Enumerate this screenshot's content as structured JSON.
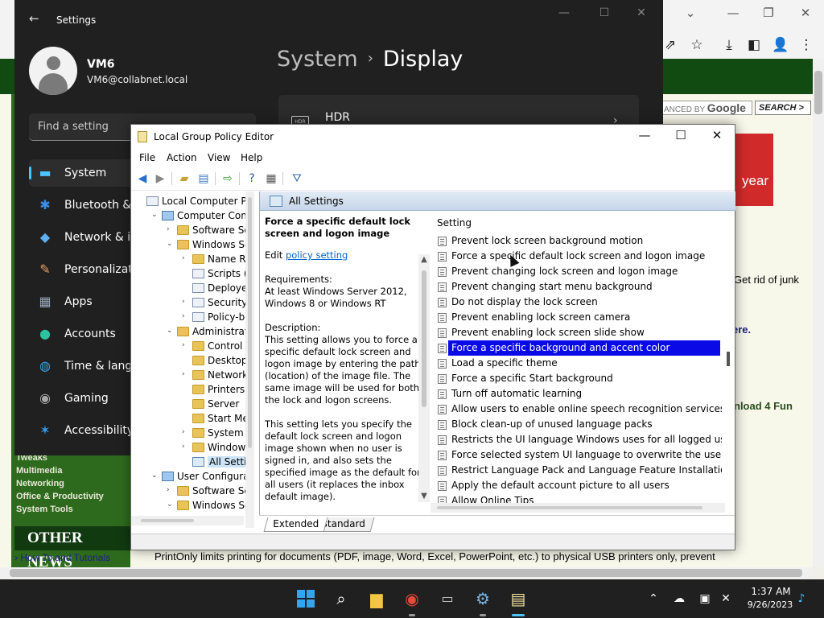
{
  "browser": {
    "google_search_placeholder": "ANCED BY",
    "google_word": "Google",
    "search_button": "SEARCH >",
    "ad_text": "year",
    "get_rid": "Get rid of junk",
    "here": "ere.",
    "download": "nload 4 Fun",
    "categories": [
      "Tweaks",
      "Multimedia",
      "Networking",
      "Office & Productivity",
      "System Tools"
    ],
    "other_news": "OTHER NEWS",
    "howto": "How To and Tutorials",
    "news_line": "PrintOnly limits printing for documents (PDF, image, Word, Excel, PowerPoint, etc.) to physical USB printers only, prevent"
  },
  "settings": {
    "title": "Settings",
    "user_name": "VM6",
    "user_email": "VM6@collabnet.local",
    "search_placeholder": "Find a setting",
    "nav": [
      {
        "label": "System",
        "icon": "display-icon"
      },
      {
        "label": "Bluetooth & c",
        "icon": "bluetooth-icon"
      },
      {
        "label": "Network & in",
        "icon": "wifi-icon"
      },
      {
        "label": "Personalizati",
        "icon": "brush-icon"
      },
      {
        "label": "Apps",
        "icon": "apps-icon"
      },
      {
        "label": "Accounts",
        "icon": "person-icon"
      },
      {
        "label": "Time & langu",
        "icon": "globe-clock-icon"
      },
      {
        "label": "Gaming",
        "icon": "gamepad-icon"
      },
      {
        "label": "Accessibility",
        "icon": "accessibility-icon"
      }
    ],
    "breadcrumb_parent": "System",
    "breadcrumb_current": "Display",
    "hdr_label": "HDR",
    "hdr_icon_text": "HDR"
  },
  "gpe": {
    "title": "Local Group Policy Editor",
    "menu": [
      "File",
      "Action",
      "View",
      "Help"
    ],
    "tree": [
      {
        "label": "Local Computer Polic",
        "indent": 0,
        "exp": "",
        "icon": "doc-icon"
      },
      {
        "label": "Computer Config",
        "indent": 1,
        "exp": "v",
        "icon": "pc-icon"
      },
      {
        "label": "Software Setti",
        "indent": 2,
        "exp": ">",
        "icon": "folder"
      },
      {
        "label": "Windows Sett",
        "indent": 2,
        "exp": "v",
        "icon": "folder"
      },
      {
        "label": "Name Res",
        "indent": 3,
        "exp": ">",
        "icon": "folder"
      },
      {
        "label": "Scripts (Sta",
        "indent": 3,
        "exp": "",
        "icon": "doc-icon"
      },
      {
        "label": "Deployed",
        "indent": 3,
        "exp": "",
        "icon": "doc-icon"
      },
      {
        "label": "Security Se",
        "indent": 3,
        "exp": ">",
        "icon": "doc-icon"
      },
      {
        "label": "Policy-bas",
        "indent": 3,
        "exp": ">",
        "icon": "doc-icon"
      },
      {
        "label": "Administrative",
        "indent": 2,
        "exp": "v",
        "icon": "folder"
      },
      {
        "label": "Control Pa",
        "indent": 3,
        "exp": ">",
        "icon": "folder"
      },
      {
        "label": "Desktop",
        "indent": 3,
        "exp": "",
        "icon": "folder"
      },
      {
        "label": "Network",
        "indent": 3,
        "exp": ">",
        "icon": "folder"
      },
      {
        "label": "Printers",
        "indent": 3,
        "exp": "",
        "icon": "folder"
      },
      {
        "label": "Server",
        "indent": 3,
        "exp": "",
        "icon": "folder"
      },
      {
        "label": "Start Menu",
        "indent": 3,
        "exp": "",
        "icon": "folder"
      },
      {
        "label": "System",
        "indent": 3,
        "exp": ">",
        "icon": "folder"
      },
      {
        "label": "Windows C",
        "indent": 3,
        "exp": ">",
        "icon": "folder"
      },
      {
        "label": "All Setting",
        "indent": 3,
        "exp": "",
        "icon": "allset-icon",
        "selected": true
      },
      {
        "label": "User Configuratio",
        "indent": 1,
        "exp": "v",
        "icon": "pc-icon"
      },
      {
        "label": "Software Setti",
        "indent": 2,
        "exp": ">",
        "icon": "folder"
      },
      {
        "label": "Windows Sett",
        "indent": 2,
        "exp": "v",
        "icon": "folder"
      }
    ],
    "pane_title": "All Settings",
    "desc_title": "Force a specific default lock screen and logon image",
    "desc_edit_prefix": "Edit ",
    "desc_edit_link": "policy setting",
    "desc_requirements": "Requirements:\nAt least Windows Server 2012, Windows 8 or Windows RT",
    "desc_description": "Description:\nThis setting allows you to force a specific default lock screen and logon image by entering the path (location) of the image file. The same image will be used for both the lock and logon screens.",
    "desc_more": "This setting lets you specify the default lock screen and logon image shown when no user is signed in, and also sets the specified image as the default for all users (it replaces the inbox default image).",
    "list_header": "Setting",
    "settings": [
      "Prevent lock screen background motion",
      "Force a specific default lock screen and logon image",
      "Prevent changing lock screen and logon image",
      "Prevent changing start menu background",
      "Do not display the lock screen",
      "Prevent enabling lock screen camera",
      "Prevent enabling lock screen slide show",
      "Force a specific background and accent color",
      "Load a specific theme",
      "Force a specific Start background",
      "Turn off automatic learning",
      "Allow users to enable online speech recognition services",
      "Block clean-up of unused language packs",
      "Restricts the UI language Windows uses for all logged users",
      "Force selected system UI language to overwrite the user UI l...",
      "Restrict Language Pack and Language Feature Installation",
      "Apply the default account picture to all users",
      "Allow Online Tips"
    ],
    "selected_index": 7,
    "tabs": [
      "Extended",
      "Standard"
    ]
  },
  "taskbar": {
    "time": "1:37 AM",
    "date": "9/26/2023"
  }
}
